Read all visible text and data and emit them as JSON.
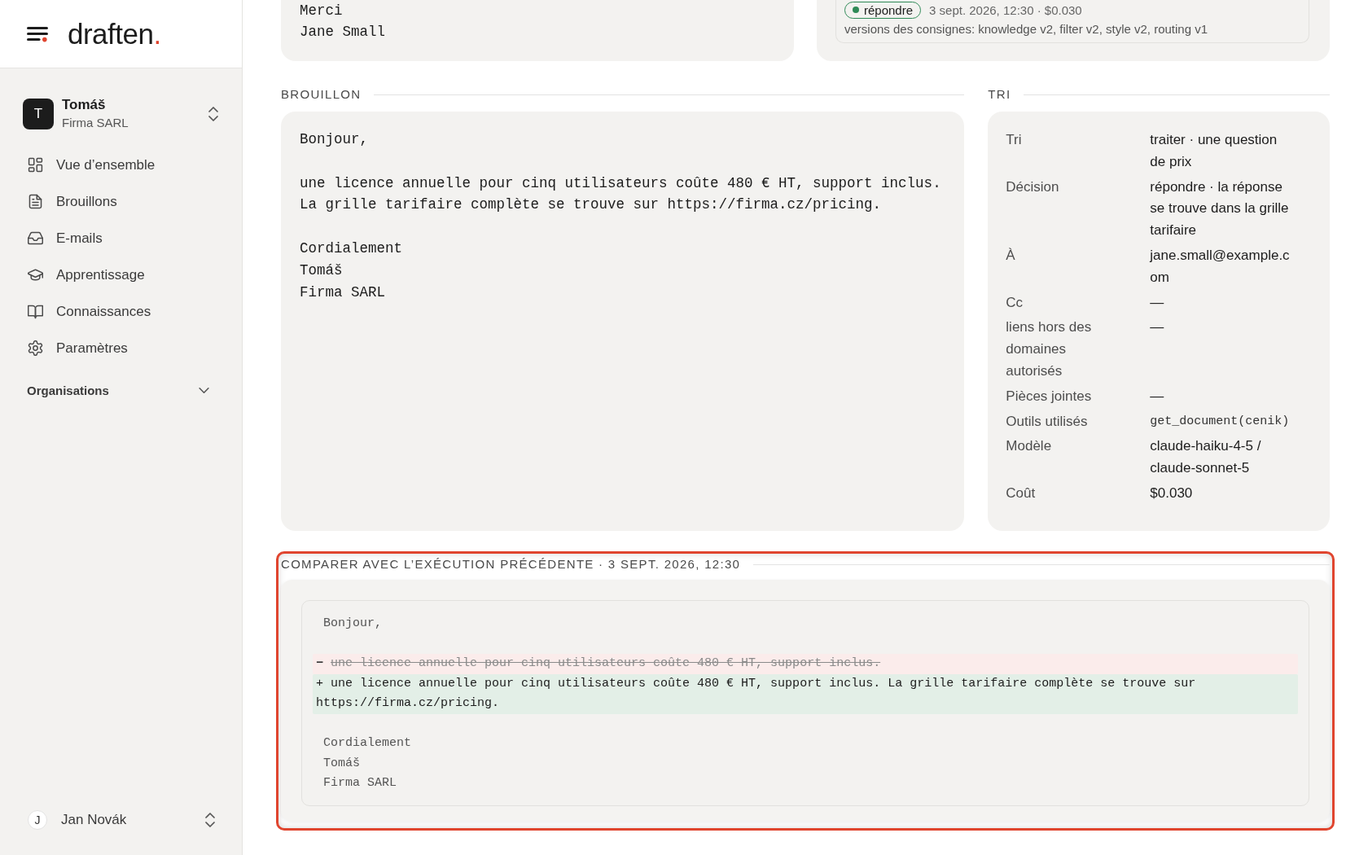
{
  "sidebar": {
    "brand": {
      "name": "draften",
      "accent": "."
    },
    "account": {
      "initial": "T",
      "name": "Tomáš",
      "organization": "Firma SARL"
    },
    "nav": [
      {
        "label": "Vue d’ensemble",
        "selected": false
      },
      {
        "label": "Brouillons",
        "selected": false
      },
      {
        "label": "E-mails",
        "selected": false
      },
      {
        "label": "Apprentissage",
        "selected": false
      },
      {
        "label": "Connaissances",
        "selected": false
      },
      {
        "label": "Paramètres",
        "selected": false
      }
    ],
    "organizations": {
      "label": "Organisations",
      "expanded": false
    },
    "user": {
      "initial": "J",
      "name": "Jan Novák"
    }
  },
  "message": {
    "text": "Merci\nJane Small"
  },
  "run": {
    "status": {
      "label": "répondre",
      "color": "#2f8a57"
    },
    "meta": "3 sept. 2026, 12:30 · $0.030",
    "prompt_versions": "versions des consignes: knowledge v2, filter v2, style v2, routing v1"
  },
  "draft": {
    "heading": "BROUILLON",
    "body": "Bonjour,\n\nune licence annuelle pour cinq utilisateurs coûte 480 € HT, support inclus. La grille tarifaire complète se trouve sur https://firma.cz/pricing.\n\nCordialement\nTomáš\nFirma SARL"
  },
  "triage": {
    "heading": "TRI",
    "rows": [
      {
        "label": "Tri",
        "value": "traiter · une question de prix",
        "kind": "text"
      },
      {
        "label": "Décision",
        "value": "répondre · la réponse se trouve dans la grille tarifaire",
        "kind": "text"
      },
      {
        "label": "À",
        "value": "jane.small@example.com",
        "kind": "text"
      },
      {
        "label": "Cc",
        "value": "—",
        "kind": "text"
      },
      {
        "label": "liens hors des domaines autorisés",
        "value": "—",
        "kind": "text"
      },
      {
        "label": "Pièces jointes",
        "value": "—",
        "kind": "text"
      },
      {
        "label": "Outils utilisés",
        "value": "get_document(cenik)",
        "kind": "code"
      },
      {
        "label": "Modèle",
        "value": "claude-haiku-4-5 / claude-sonnet-5",
        "kind": "text"
      },
      {
        "label": "Coût",
        "value": "$0.030",
        "kind": "text"
      }
    ]
  },
  "comparison": {
    "heading": "COMPARER AVEC L’EXÉCUTION PRÉCÉDENTE · 3 SEPT. 2026, 12:30",
    "highlighted": true,
    "lines": [
      {
        "kind": "context",
        "text": "Bonjour,"
      },
      {
        "kind": "blank"
      },
      {
        "kind": "removed",
        "sign": "−",
        "text": "une licence annuelle pour cinq utilisateurs coûte 480 € HT, support inclus."
      },
      {
        "kind": "added",
        "sign": "+",
        "text": "une licence annuelle pour cinq utilisateurs coûte 480 € HT, support inclus. La grille tarifaire complète se trouve sur https://firma.cz/pricing."
      },
      {
        "kind": "blank"
      },
      {
        "kind": "context",
        "text": "Cordialement"
      },
      {
        "kind": "context",
        "text": "Tomáš"
      },
      {
        "kind": "context",
        "text": "Firma SARL"
      }
    ]
  }
}
